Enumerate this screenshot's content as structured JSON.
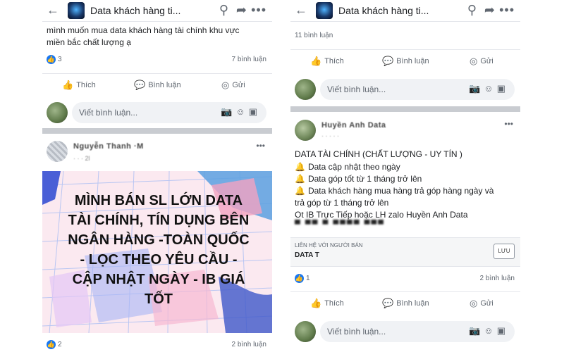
{
  "common": {
    "group_title": "Data khách hàng ti...",
    "like_label": "Thích",
    "comment_label": "Bình luận",
    "send_label": "Gửi",
    "comment_placeholder": "Viết bình luận...",
    "icons": [
      "back-arrow-icon",
      "search-icon",
      "share-icon",
      "more-icon",
      "like-icon",
      "comment-icon",
      "messenger-icon",
      "camera-icon",
      "emoji-icon",
      "sticker-icon"
    ]
  },
  "left": {
    "post1": {
      "text_line1": "mình muốn mua data khách hàng tài chính khu vực",
      "text_line2": "miền bắc chất lượng ạ",
      "likes": "3",
      "comments": "7 bình luận"
    },
    "post2": {
      "author": "Nguyễn Thanh ·M",
      "time": "· · · 2l",
      "banner_text": "MÌNH BÁN SL LỚN DATA\nTÀI CHÍNH, TÍN DỤNG BÊN\nNGÂN HÀNG -TOÀN QUỐC\n- LỌC THEO YÊU CẦU -\nCẬP NHẬT NGÀY - IB GIÁ\nTỐT",
      "likes": "2",
      "comments": "2 bình luận"
    }
  },
  "right": {
    "post1": {
      "comments": "11 bình luận"
    },
    "post2": {
      "author": "Huyền Anh Data",
      "time": "· · · · ·",
      "heading": "DATA TÀI CHÍNH (CHẤT LƯỢNG - UY TÍN )",
      "bullets": [
        "Data cập nhật theo ngày",
        "Data góp tốt từ 1 tháng trở lên",
        "Data khách hàng mua hàng trả góp hàng ngày và"
      ],
      "line_continued": "trả góp từ 1 tháng trở lên",
      "contact_line": "Ot IB Trực Tiếp hoặc LH zalo Huyền Anh Data",
      "blurred_line": "▀ ▀▀ ▀ ▀▀▀▀ ▀▀▀",
      "seller_label": "LIÊN HỆ VỚI NGƯỜI BÁN",
      "seller_name": "DATA T",
      "save_label": "LƯU",
      "likes": "1",
      "comments": "2 bình luận"
    }
  },
  "colors": {
    "facebook_blue": "#1877f2",
    "divider_gray": "#c9ccd1",
    "banner_pink": "#fbe9f0"
  }
}
